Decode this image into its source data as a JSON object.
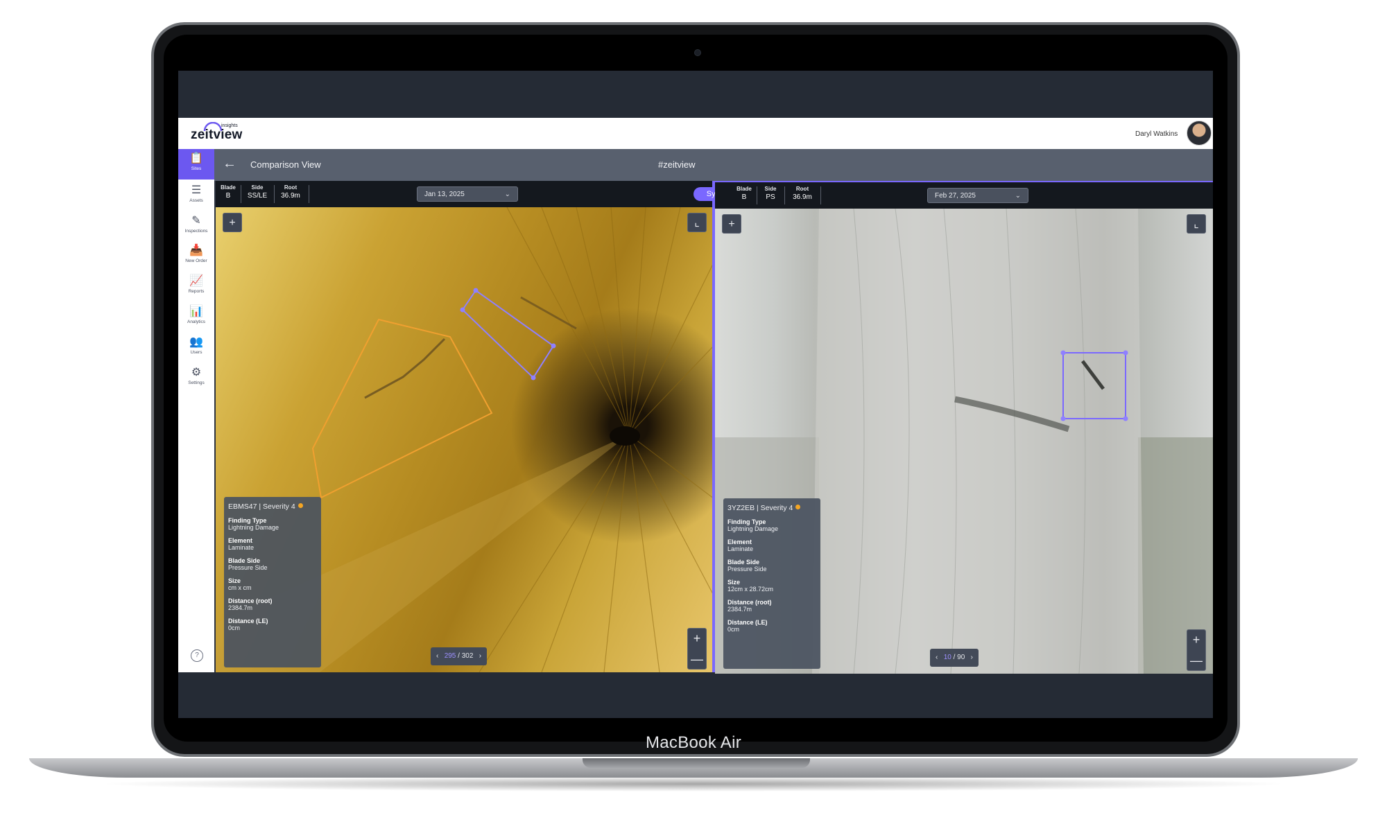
{
  "device": {
    "label": "MacBook Air"
  },
  "app": {
    "logo": {
      "word": "zeitview",
      "sub": "insights"
    },
    "user": {
      "name": "Daryl Watkins"
    },
    "sidebar": {
      "items": [
        {
          "label": "Sites",
          "icon": "clipboard-icon",
          "active": true
        },
        {
          "label": "Assets",
          "icon": "layers-icon"
        },
        {
          "label": "Inspections",
          "icon": "pen-icon"
        },
        {
          "label": "New Order",
          "icon": "inbox-icon"
        },
        {
          "label": "Reports",
          "icon": "line-chart-icon"
        },
        {
          "label": "Analytics",
          "icon": "bar-chart-icon"
        },
        {
          "label": "Users",
          "icon": "users-icon"
        },
        {
          "label": "Settings",
          "icon": "gear-icon"
        }
      ],
      "help": "?"
    },
    "titlebar": {
      "title": "Comparison View",
      "center": "#zeitview"
    },
    "sync_label": "Sync",
    "left": {
      "meta": [
        {
          "key": "Blade",
          "value": "B"
        },
        {
          "key": "Side",
          "value": "SS/LE"
        },
        {
          "key": "Root",
          "value": "36.9m"
        }
      ],
      "date": "Jan 13, 2025",
      "card": {
        "title": "EBMS47 | Severity 4",
        "fields": [
          {
            "key": "Finding Type",
            "value": "Lightning Damage"
          },
          {
            "key": "Element",
            "value": "Laminate"
          },
          {
            "key": "Blade Side",
            "value": "Pressure Side"
          },
          {
            "key": "Size",
            "value": "cm x cm"
          },
          {
            "key": "Distance (root)",
            "value": "2384.7m"
          },
          {
            "key": "Distance (LE)",
            "value": "0cm"
          }
        ]
      },
      "pager": {
        "current": "295",
        "sep": "/",
        "total": "302"
      },
      "annotation_color": "#f0a030"
    },
    "right": {
      "meta": [
        {
          "key": "Blade",
          "value": "B"
        },
        {
          "key": "Side",
          "value": "PS"
        },
        {
          "key": "Root",
          "value": "36.9m"
        }
      ],
      "date": "Feb 27, 2025",
      "card": {
        "title": "3YZ2EB | Severity 4",
        "fields": [
          {
            "key": "Finding Type",
            "value": "Lightning Damage"
          },
          {
            "key": "Element",
            "value": "Laminate"
          },
          {
            "key": "Blade Side",
            "value": "Pressure Side"
          },
          {
            "key": "Size",
            "value": "12cm x 28.72cm"
          },
          {
            "key": "Distance (root)",
            "value": "2384.7m"
          },
          {
            "key": "Distance (LE)",
            "value": "0cm"
          }
        ]
      },
      "pager": {
        "current": "10",
        "sep": "/",
        "total": "90"
      },
      "annotation_color": "#7a68ff"
    },
    "colors": {
      "accent": "#7a68ff",
      "severity": "#f5a623",
      "header": "#58606e"
    }
  }
}
